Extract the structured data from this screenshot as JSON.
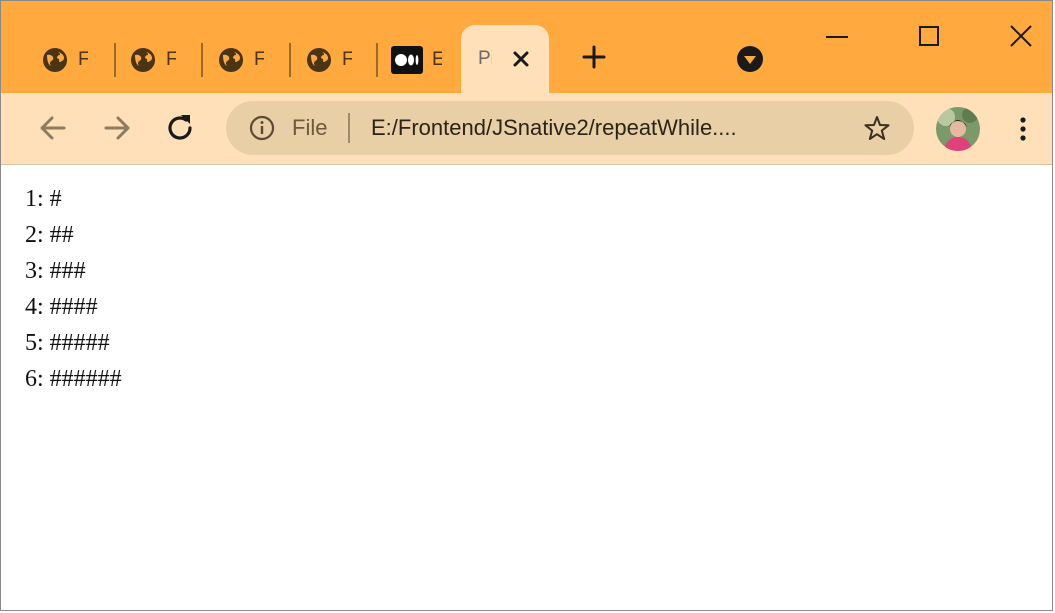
{
  "tabs": [
    {
      "title": "F",
      "icon": "globe-icon"
    },
    {
      "title": "F",
      "icon": "globe-icon"
    },
    {
      "title": "F",
      "icon": "globe-icon"
    },
    {
      "title": "F",
      "icon": "globe-icon"
    },
    {
      "title": "E",
      "icon": "medium-logo-icon"
    },
    {
      "title": "Pi",
      "icon": "none",
      "active": true
    }
  ],
  "toolbar": {
    "file_label": "File",
    "url": "E:/Frontend/JSnative2/repeatWhile...."
  },
  "content": {
    "lines": [
      "1: #",
      "2: ##",
      "3: ###",
      "4: ####",
      "5: #####",
      "6: ######"
    ]
  },
  "colors": {
    "titlebar": "#ffa93f",
    "toolbar": "#ffe0b8",
    "omnibox": "#e8cfa6",
    "icons": "#4a3415"
  }
}
